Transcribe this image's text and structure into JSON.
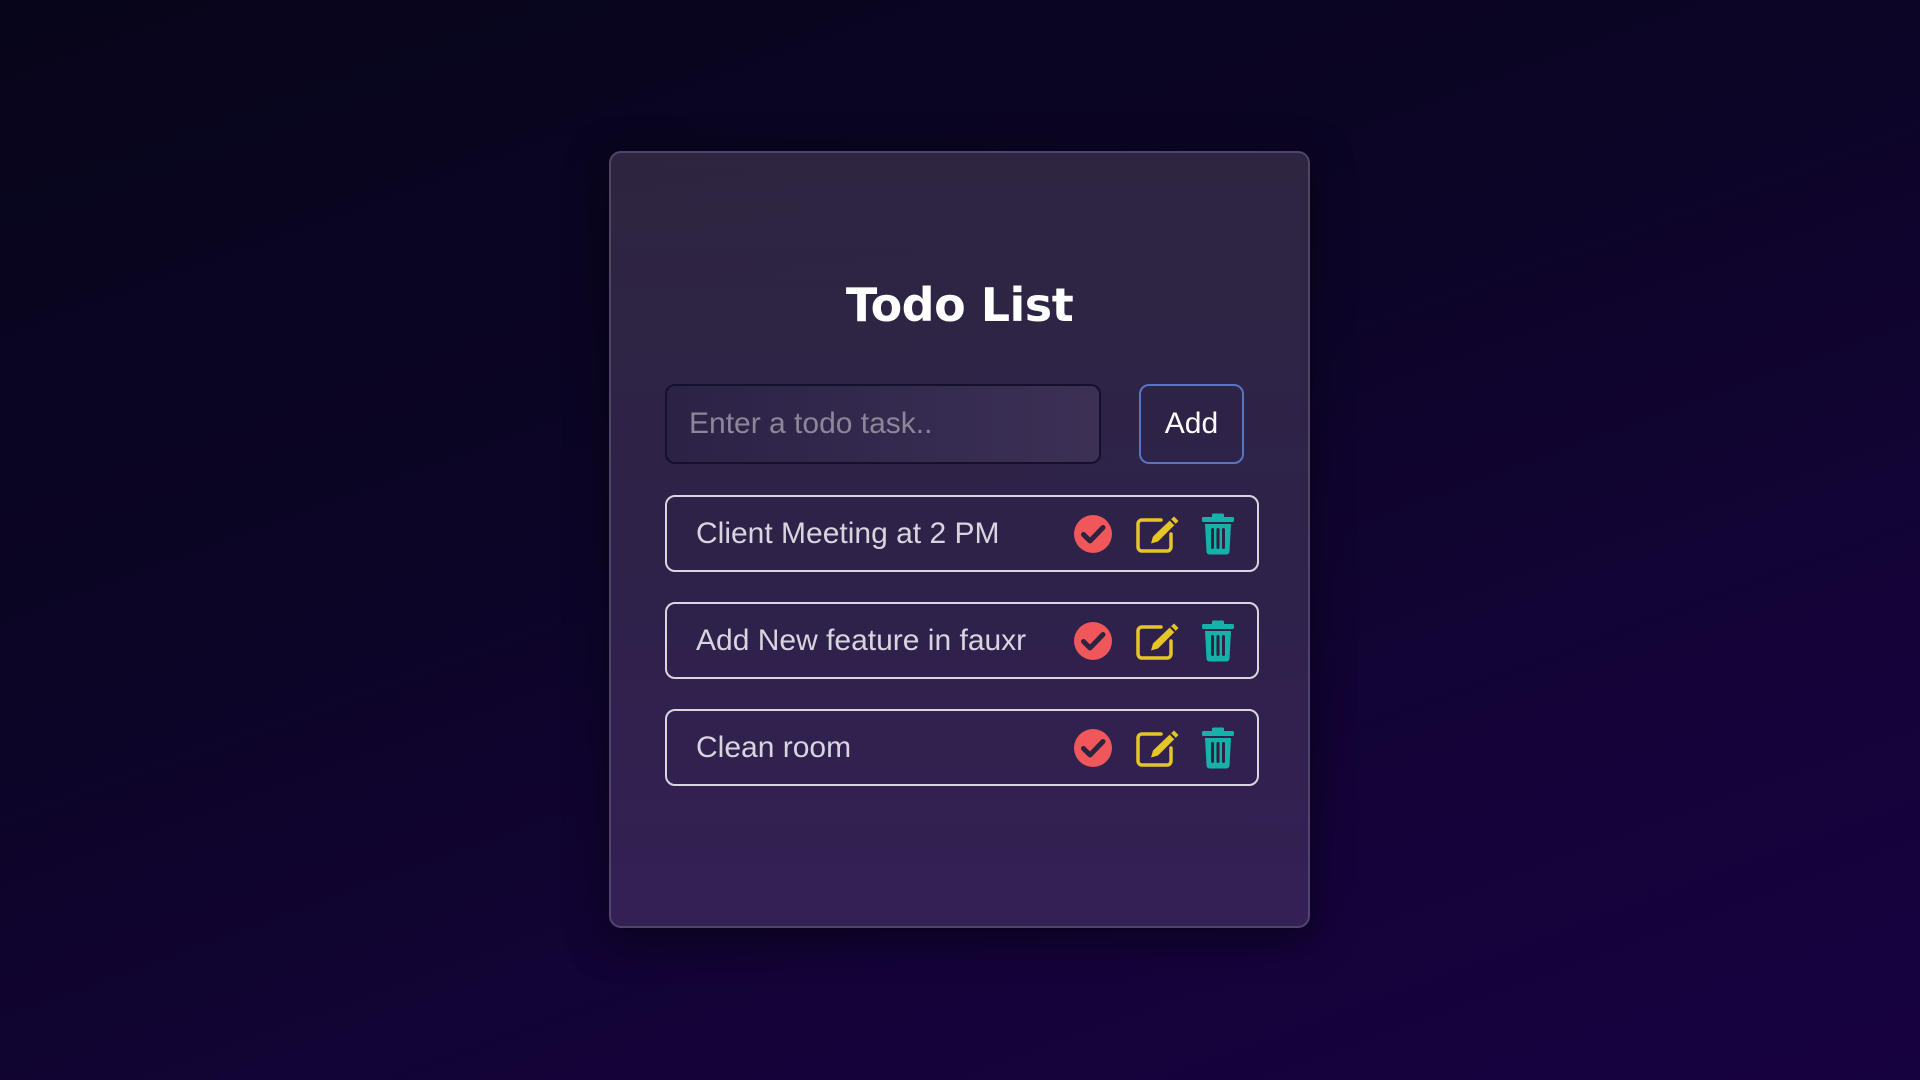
{
  "app": {
    "title": "Todo List"
  },
  "input": {
    "placeholder": "Enter a todo task..",
    "value": ""
  },
  "add_button": {
    "label": "Add"
  },
  "todos": [
    {
      "text": "Client Meeting at 2 PM"
    },
    {
      "text": "Add New feature in fauxr"
    },
    {
      "text": "Clean room"
    }
  ],
  "icons": {
    "complete": "check-circle-icon",
    "edit": "edit-icon",
    "delete": "trash-icon"
  },
  "colors": {
    "complete": "#f0575b",
    "edit": "#e6c527",
    "delete": "#14b2a9",
    "add_border": "#5a74c4"
  }
}
